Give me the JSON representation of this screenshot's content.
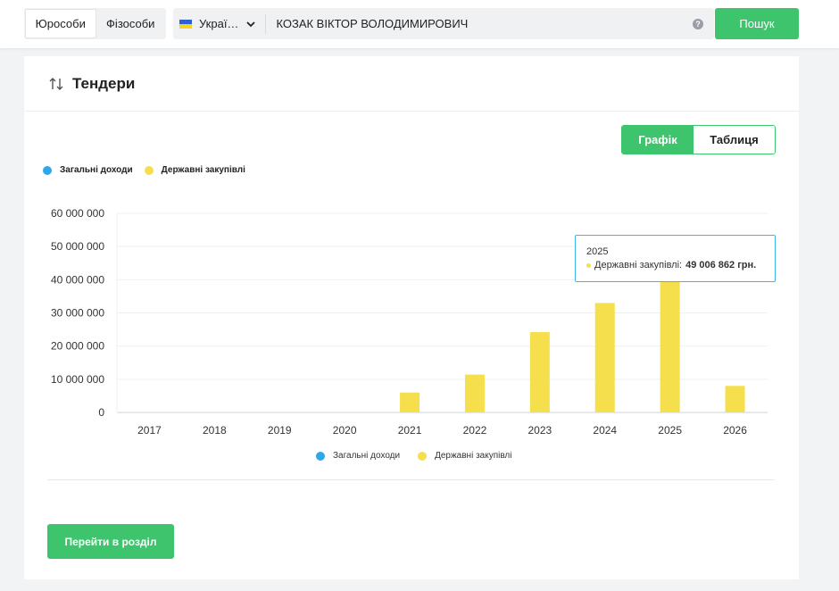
{
  "header": {
    "tabs": [
      "Юрособи",
      "Фізособи"
    ],
    "active_tab": 0,
    "country": "Украї…",
    "query": "КОЗАК ВІКТОР ВОЛОДИМИРОВИЧ",
    "help": "?",
    "search_button": "Пошук"
  },
  "section": {
    "title": "Тендери",
    "view_toggle": [
      "Графік",
      "Таблиця"
    ],
    "active_view": 0,
    "goto_button": "Перейти в розділ"
  },
  "legend": [
    {
      "label": "Загальні доходи",
      "color": "#2ea8e6"
    },
    {
      "label": "Державні закупівлі",
      "color": "#f5df4d"
    }
  ],
  "tooltip": {
    "year": "2025",
    "label": "Державні закупівлі:",
    "value": "49 006 862 грн."
  },
  "chart_data": {
    "type": "bar",
    "categories": [
      "2017",
      "2018",
      "2019",
      "2020",
      "2021",
      "2022",
      "2023",
      "2024",
      "2025",
      "2026"
    ],
    "series": [
      {
        "name": "Загальні доходи",
        "color": "#2ea8e6",
        "values": [
          0,
          0,
          0,
          0,
          0,
          0,
          0,
          0,
          0,
          0
        ]
      },
      {
        "name": "Державні закупівлі",
        "color": "#f5df4d",
        "values": [
          0,
          0,
          0,
          0,
          6000000,
          11400000,
          24200000,
          33000000,
          49006862,
          8000000
        ]
      }
    ],
    "ylim": [
      0,
      60000000
    ],
    "yticks": [
      0,
      10000000,
      20000000,
      30000000,
      40000000,
      50000000,
      60000000
    ],
    "ytick_labels": [
      "0",
      "10 000 000",
      "20 000 000",
      "30 000 000",
      "40 000 000",
      "50 000 000",
      "60 000 000"
    ],
    "grid": true,
    "legend_position": "top-left and bottom-center"
  }
}
